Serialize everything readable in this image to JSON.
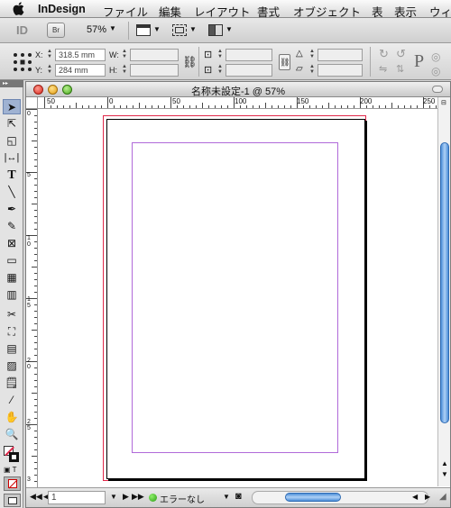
{
  "menubar": {
    "app_name": "InDesign",
    "items": [
      "ファイル",
      "編集",
      "レイアウト",
      "書式",
      "オブジェクト",
      "表",
      "表示",
      "ウィ"
    ]
  },
  "appbar": {
    "bridge_label": "Br",
    "zoom": "57%"
  },
  "control_panel": {
    "x_label": "X:",
    "x_value": "318.5 mm",
    "y_label": "Y:",
    "y_value": "284 mm",
    "w_label": "W:",
    "h_label": "H:",
    "paragraph_glyph": "P"
  },
  "document": {
    "title": "名称未設定-1 @ 57%",
    "ruler_h_labels": [
      "50",
      "0",
      "50",
      "100",
      "150",
      "200",
      "250"
    ],
    "ruler_v_labels": [
      "0",
      "5",
      "1 0",
      "1 5",
      "2 0",
      "2 5",
      "3"
    ],
    "page_field": "1",
    "preflight_status": "エラーなし"
  },
  "colors": {
    "bleed": "#e0284a",
    "margin": "#b06ad9",
    "scroll_thumb": "#4d8fd9"
  }
}
